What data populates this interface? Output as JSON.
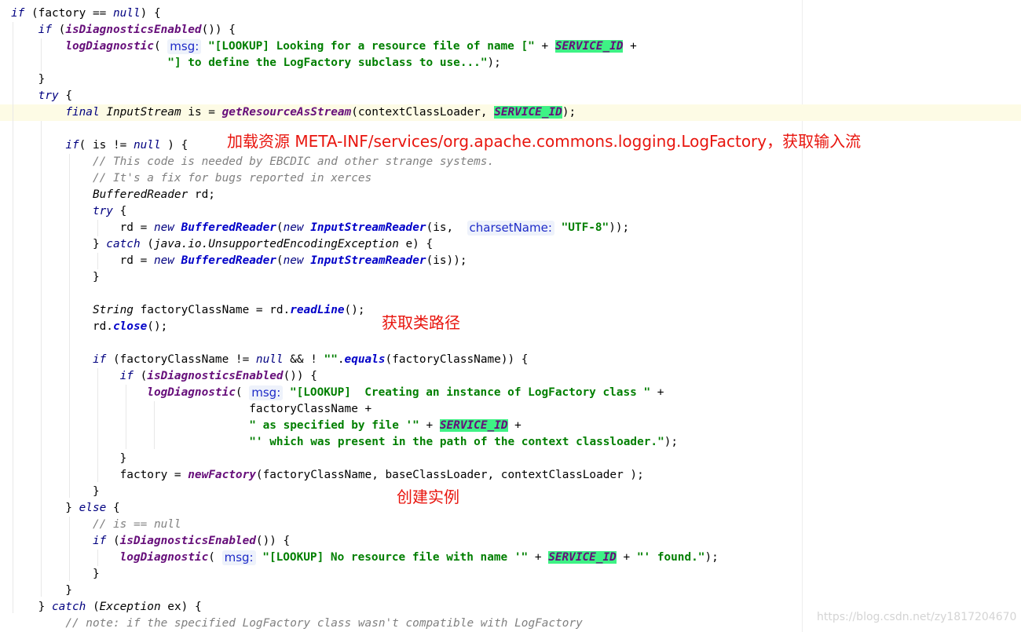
{
  "editor": {
    "lines": [
      [
        {
          "t": "if",
          "c": "kw"
        },
        {
          "t": " (factory == "
        },
        {
          "t": "null",
          "c": "kw"
        },
        {
          "t": ") {"
        }
      ],
      [
        {
          "t": "    "
        },
        {
          "t": "if",
          "c": "kw"
        },
        {
          "t": " ("
        },
        {
          "t": "isDiagnosticsEnabled",
          "c": "mcs"
        },
        {
          "t": "()) {"
        }
      ],
      [
        {
          "t": "        "
        },
        {
          "t": "logDiagnostic",
          "c": "mcs"
        },
        {
          "t": "( "
        },
        {
          "t": "msg:",
          "c": "hint"
        },
        {
          "t": " "
        },
        {
          "t": "\"[LOOKUP] Looking for a resource file of name [\"",
          "c": "st"
        },
        {
          "t": " + "
        },
        {
          "t": "SERVICE_ID",
          "c": "cf"
        },
        {
          "t": " +"
        }
      ],
      [
        {
          "t": "                       "
        },
        {
          "t": "\"] to define the LogFactory subclass to use...\"",
          "c": "st"
        },
        {
          "t": ");"
        }
      ],
      [
        {
          "t": "    }"
        }
      ],
      [
        {
          "t": "    "
        },
        {
          "t": "try",
          "c": "kw"
        },
        {
          "t": " {"
        }
      ],
      [
        {
          "t": "        "
        },
        {
          "t": "final",
          "c": "kw"
        },
        {
          "t": " "
        },
        {
          "t": "InputStream",
          "c": "mc"
        },
        {
          "t": " is = "
        },
        {
          "t": "getResourceAsStream",
          "c": "mcs"
        },
        {
          "t": "(contextClassLoader, "
        },
        {
          "t": "SERVICE_ID",
          "c": "cf"
        },
        {
          "t": ");"
        }
      ],
      [
        {
          "t": ""
        }
      ],
      [
        {
          "t": "        "
        },
        {
          "t": "if",
          "c": "kw"
        },
        {
          "t": "( is != "
        },
        {
          "t": "null",
          "c": "kw"
        },
        {
          "t": " ) {"
        }
      ],
      [
        {
          "t": "            "
        },
        {
          "t": "// This code is needed by EBCDIC and other strange systems.",
          "c": "cm"
        }
      ],
      [
        {
          "t": "            "
        },
        {
          "t": "// It's a fix for bugs reported in xerces",
          "c": "cm"
        }
      ],
      [
        {
          "t": "            "
        },
        {
          "t": "BufferedReader",
          "c": "mc"
        },
        {
          "t": " rd;"
        }
      ],
      [
        {
          "t": "            "
        },
        {
          "t": "try",
          "c": "kw"
        },
        {
          "t": " {"
        }
      ],
      [
        {
          "t": "                rd = "
        },
        {
          "t": "new",
          "c": "kw"
        },
        {
          "t": " "
        },
        {
          "t": "BufferedReader",
          "c": "mcd"
        },
        {
          "t": "("
        },
        {
          "t": "new",
          "c": "kw"
        },
        {
          "t": " "
        },
        {
          "t": "InputStreamReader",
          "c": "mcd"
        },
        {
          "t": "(is,  "
        },
        {
          "t": "charsetName:",
          "c": "hint"
        },
        {
          "t": " "
        },
        {
          "t": "\"UTF-8\"",
          "c": "st"
        },
        {
          "t": "));"
        }
      ],
      [
        {
          "t": "            } "
        },
        {
          "t": "catch",
          "c": "kw"
        },
        {
          "t": " ("
        },
        {
          "t": "java.io.UnsupportedEncodingException",
          "c": "mc"
        },
        {
          "t": " e) {"
        }
      ],
      [
        {
          "t": "                rd = "
        },
        {
          "t": "new",
          "c": "kw"
        },
        {
          "t": " "
        },
        {
          "t": "BufferedReader",
          "c": "mcd"
        },
        {
          "t": "("
        },
        {
          "t": "new",
          "c": "kw"
        },
        {
          "t": " "
        },
        {
          "t": "InputStreamReader",
          "c": "mcd"
        },
        {
          "t": "(is));"
        }
      ],
      [
        {
          "t": "            }"
        }
      ],
      [
        {
          "t": ""
        }
      ],
      [
        {
          "t": "            "
        },
        {
          "t": "String",
          "c": "mc"
        },
        {
          "t": " factoryClassName = rd."
        },
        {
          "t": "readLine",
          "c": "mcd"
        },
        {
          "t": "();"
        }
      ],
      [
        {
          "t": "            rd."
        },
        {
          "t": "close",
          "c": "mcd"
        },
        {
          "t": "();"
        }
      ],
      [
        {
          "t": ""
        }
      ],
      [
        {
          "t": "            "
        },
        {
          "t": "if",
          "c": "kw"
        },
        {
          "t": " (factoryClassName != "
        },
        {
          "t": "null",
          "c": "kw"
        },
        {
          "t": " && ! "
        },
        {
          "t": "\"\"",
          "c": "st"
        },
        {
          "t": "."
        },
        {
          "t": "equals",
          "c": "mcd"
        },
        {
          "t": "(factoryClassName)) {"
        }
      ],
      [
        {
          "t": "                "
        },
        {
          "t": "if",
          "c": "kw"
        },
        {
          "t": " ("
        },
        {
          "t": "isDiagnosticsEnabled",
          "c": "mcs"
        },
        {
          "t": "()) {"
        }
      ],
      [
        {
          "t": "                    "
        },
        {
          "t": "logDiagnostic",
          "c": "mcs"
        },
        {
          "t": "( "
        },
        {
          "t": "msg:",
          "c": "hint"
        },
        {
          "t": " "
        },
        {
          "t": "\"[LOOKUP]  Creating an instance of LogFactory class \"",
          "c": "st"
        },
        {
          "t": " +"
        }
      ],
      [
        {
          "t": "                                   factoryClassName +"
        }
      ],
      [
        {
          "t": "                                   "
        },
        {
          "t": "\" as specified by file '\"",
          "c": "st"
        },
        {
          "t": " + "
        },
        {
          "t": "SERVICE_ID",
          "c": "cf"
        },
        {
          "t": " +"
        }
      ],
      [
        {
          "t": "                                   "
        },
        {
          "t": "\"' which was present in the path of the context classloader.\"",
          "c": "st"
        },
        {
          "t": ");"
        }
      ],
      [
        {
          "t": "                }"
        }
      ],
      [
        {
          "t": "                factory = "
        },
        {
          "t": "newFactory",
          "c": "mcs"
        },
        {
          "t": "(factoryClassName, baseClassLoader, contextClassLoader );"
        }
      ],
      [
        {
          "t": "            }"
        }
      ],
      [
        {
          "t": "        } "
        },
        {
          "t": "else",
          "c": "kw"
        },
        {
          "t": " {"
        }
      ],
      [
        {
          "t": "            "
        },
        {
          "t": "// is == null",
          "c": "cm"
        }
      ],
      [
        {
          "t": "            "
        },
        {
          "t": "if",
          "c": "kw"
        },
        {
          "t": " ("
        },
        {
          "t": "isDiagnosticsEnabled",
          "c": "mcs"
        },
        {
          "t": "()) {"
        }
      ],
      [
        {
          "t": "                "
        },
        {
          "t": "logDiagnostic",
          "c": "mcs"
        },
        {
          "t": "( "
        },
        {
          "t": "msg:",
          "c": "hint"
        },
        {
          "t": " "
        },
        {
          "t": "\"[LOOKUP] No resource file with name '\"",
          "c": "st"
        },
        {
          "t": " + "
        },
        {
          "t": "SERVICE_ID",
          "c": "cf"
        },
        {
          "t": " + "
        },
        {
          "t": "\"' found.\"",
          "c": "st"
        },
        {
          "t": ");"
        }
      ],
      [
        {
          "t": "            }"
        }
      ],
      [
        {
          "t": "        }"
        }
      ],
      [
        {
          "t": "    } "
        },
        {
          "t": "catch",
          "c": "kw"
        },
        {
          "t": " ("
        },
        {
          "t": "Exception",
          "c": "mc"
        },
        {
          "t": " ex) {"
        }
      ],
      [
        {
          "t": "        "
        },
        {
          "t": "// note: if the specified LogFactory class wasn't compatible with LogFactory",
          "c": "cm"
        }
      ]
    ],
    "highlighted_line": 6
  },
  "annotations": {
    "load_resource": "加载资源 META-INF/services/org.apache.commons.logging.LogFactory，获取输入流",
    "get_class_path": "获取类路径",
    "create_instance": "创建实例"
  },
  "watermark": "https://blog.csdn.net/zy1817204670",
  "colors": {
    "keyword": "#000080",
    "string": "#007f00",
    "constant_highlight_bg": "#3ef285",
    "static_method": "#660e7a",
    "instance_method": "#0000c8",
    "comment": "#808080",
    "annotation_text": "#e8150e",
    "param_hint_text": "#1e2bc8",
    "current_line_bg": "#fdfbe5"
  }
}
